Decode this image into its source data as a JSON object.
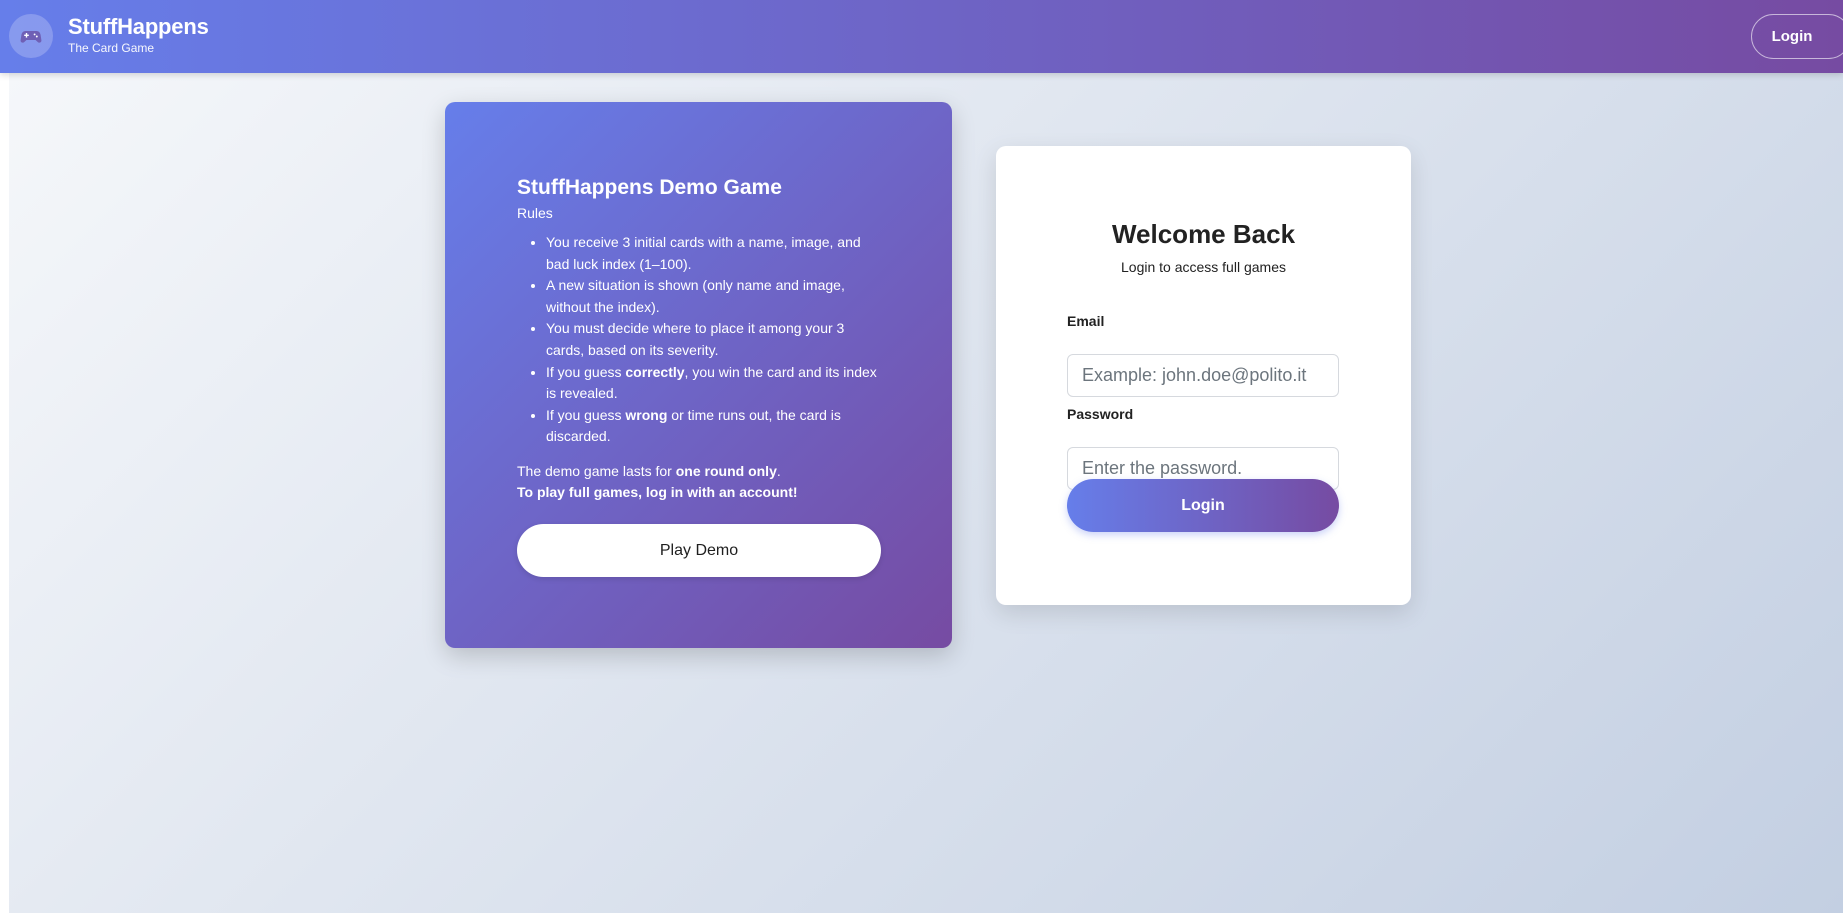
{
  "navbar": {
    "logo_icon": "gamepad-icon",
    "title": "StuffHappens",
    "subtitle": "The Card Game",
    "login_label": "Login"
  },
  "demo": {
    "title": "StuffHappens Demo Game",
    "rules_label": "Rules",
    "rules": [
      {
        "pre": "You receive 3 initial cards with a name, image, and bad luck index (1–100).",
        "bold": "",
        "post": ""
      },
      {
        "pre": "A new situation is shown (only name and image, without the index).",
        "bold": "",
        "post": ""
      },
      {
        "pre": "You must decide where to place it among your 3 cards, based on its severity.",
        "bold": "",
        "post": ""
      },
      {
        "pre": "If you guess ",
        "bold": "correctly",
        "post": ", you win the card and its index is revealed."
      },
      {
        "pre": "If you guess ",
        "bold": "wrong",
        "post": " or time runs out, the card is discarded."
      }
    ],
    "note_pre": "The demo game lasts for ",
    "note_bold": "one round only",
    "note_post": ".",
    "note2": "To play full games, log in with an account!",
    "play_label": "Play Demo"
  },
  "login": {
    "title": "Welcome Back",
    "subtitle": "Login to access full games",
    "email_label": "Email",
    "email_placeholder": "Example: john.doe@polito.it",
    "email_value": "",
    "password_label": "Password",
    "password_placeholder": "Enter the password.",
    "password_value": "",
    "submit_label": "Login"
  },
  "colors": {
    "gradient_start": "#667eea",
    "gradient_end": "#764ba2",
    "background_start": "#f5f7fa",
    "background_end": "#c3cfe2"
  }
}
